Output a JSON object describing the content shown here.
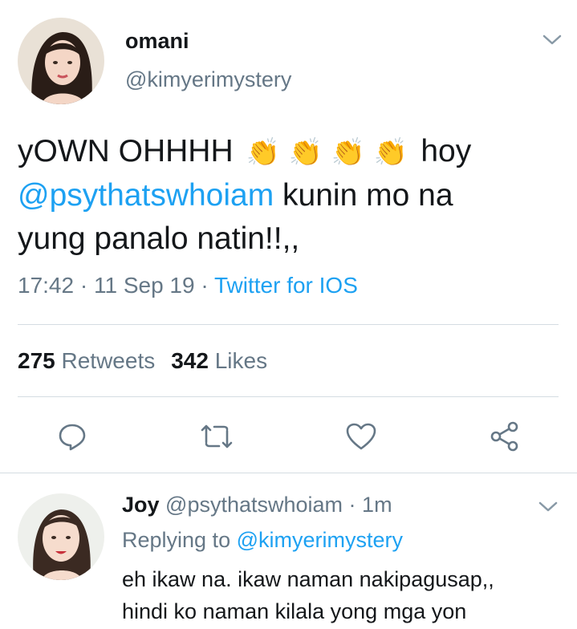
{
  "tweet": {
    "author": {
      "name": "omani",
      "handle": "@kimyerimystery"
    },
    "text": {
      "line1_prefix": "yOWN OHHHH",
      "clap_emoji": "👏",
      "line1_suffix": "hoy",
      "mention": "@psythatswhoiam",
      "line2_suffix": " kunin mo na",
      "line3": "yung panalo natin!!,,"
    },
    "time": "17:42",
    "date": "11 Sep 19",
    "separator": " · ",
    "source": "Twitter for IOS",
    "stats": {
      "retweets_count": "275",
      "retweets_label": "Retweets",
      "likes_count": "342",
      "likes_label": "Likes"
    },
    "actions": [
      "reply-icon",
      "retweet-icon",
      "like-icon",
      "share-icon"
    ]
  },
  "reply": {
    "author": {
      "name": "Joy",
      "handle": "@psythatswhoiam"
    },
    "age": "1m",
    "replying_to_label": "Replying to",
    "replying_to_handle": "@kimyerimystery",
    "text_line1": "eh ikaw na. ikaw naman nakipagusap,,",
    "text_line2": "hindi ko naman kilala yong mga yon"
  },
  "colors": {
    "accent": "#1da1f2",
    "text": "#14171a",
    "secondary": "#657786",
    "divider": "#d4dce2"
  }
}
